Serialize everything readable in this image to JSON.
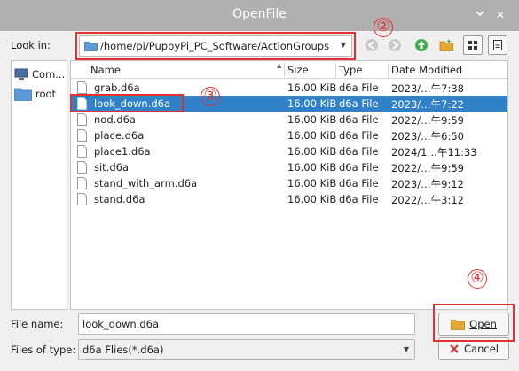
{
  "window": {
    "title": "OpenFile",
    "close_glyph": "✕"
  },
  "toolbar": {
    "look_in_label": "Look in:",
    "path": "/home/pi/PuppyPi_PC_Software/ActionGroups",
    "icons": [
      "back-arrow-icon",
      "forward-arrow-icon",
      "parent-folder-icon",
      "new-folder-icon",
      "list-view-icon",
      "detail-view-icon"
    ]
  },
  "places": [
    {
      "label": "Com...",
      "icon": "computer-icon"
    },
    {
      "label": "root",
      "icon": "folder-icon"
    }
  ],
  "columns": {
    "name": "Name",
    "size": "Size",
    "type": "Type",
    "date": "Date Modified"
  },
  "files": [
    {
      "name": "grab.d6a",
      "size": "16.00 KiB",
      "type": "d6a File",
      "date": "2023/…午7:38",
      "selected": false
    },
    {
      "name": "look_down.d6a",
      "size": "16.00 KiB",
      "type": "d6a File",
      "date": "2023/…午7:22",
      "selected": true
    },
    {
      "name": "nod.d6a",
      "size": "16.00 KiB",
      "type": "d6a File",
      "date": "2022/…午9:59",
      "selected": false
    },
    {
      "name": "place.d6a",
      "size": "16.00 KiB",
      "type": "d6a File",
      "date": "2023/…午6:50",
      "selected": false
    },
    {
      "name": "place1.d6a",
      "size": "16.00 KiB",
      "type": "d6a File",
      "date": "2024/1…午11:33",
      "selected": false
    },
    {
      "name": "sit.d6a",
      "size": "16.00 KiB",
      "type": "d6a File",
      "date": "2022/…午9:59",
      "selected": false
    },
    {
      "name": "stand_with_arm.d6a",
      "size": "16.00 KiB",
      "type": "d6a File",
      "date": "2023/…午9:12",
      "selected": false
    },
    {
      "name": "stand.d6a",
      "size": "16.00 KiB",
      "type": "d6a File",
      "date": "2022/…午3:12",
      "selected": false
    }
  ],
  "footer": {
    "file_name_label": "File name:",
    "file_name_value": "look_down.d6a",
    "file_type_label": "Files of type:",
    "file_type_value": "d6a Flies(*.d6a)",
    "open_label": "Open",
    "cancel_label": "Cancel"
  },
  "annotations": {
    "step2": "②",
    "step3": "③",
    "step4": "④"
  },
  "colors": {
    "selection": "#3081c8",
    "annotation": "#e53030",
    "titlebar": "#b0b0b0"
  }
}
